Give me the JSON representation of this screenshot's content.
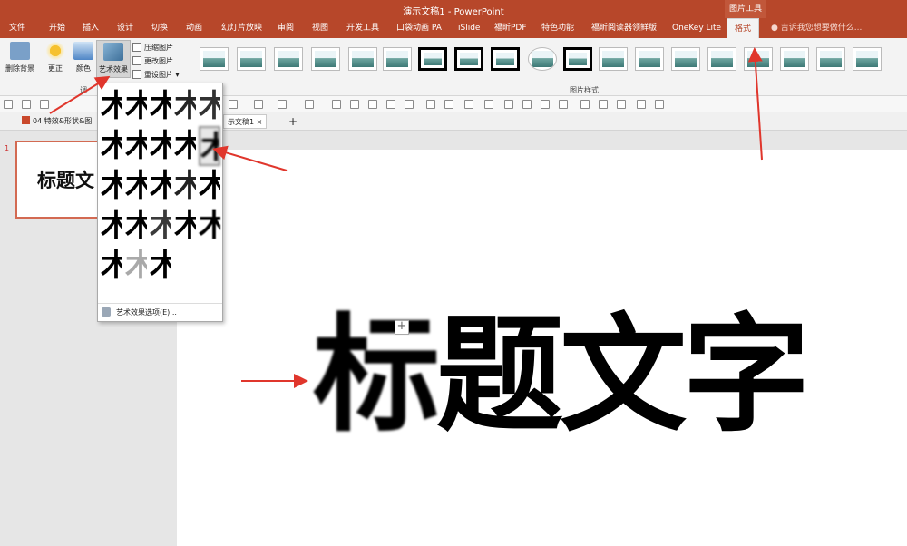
{
  "window": {
    "title": "演示文稿1 - PowerPoint",
    "context_group": "图片工具"
  },
  "tabs": [
    {
      "label": "文件"
    },
    {
      "label": "开始"
    },
    {
      "label": "插入"
    },
    {
      "label": "设计"
    },
    {
      "label": "切换"
    },
    {
      "label": "动画"
    },
    {
      "label": "幻灯片放映"
    },
    {
      "label": "审阅"
    },
    {
      "label": "视图"
    },
    {
      "label": "开发工具"
    },
    {
      "label": "口袋动画 PA"
    },
    {
      "label": "iSlide"
    },
    {
      "label": "福昕PDF"
    },
    {
      "label": "特色功能"
    },
    {
      "label": "福昕阅读器领鲜版"
    },
    {
      "label": "OneKey Lite"
    },
    {
      "label": "格式"
    }
  ],
  "tell_me": "吉诉我您想要做什么...",
  "ribbon": {
    "remove_bg": "删除背景",
    "corrections": "更正",
    "color": "颜色",
    "artistic_effects": "艺术效果",
    "compress": "压缩图片",
    "change": "更改图片",
    "reset": "重设图片",
    "styles_group": "图片样式",
    "adjust_group": "调"
  },
  "doc_tabs": {
    "file": "04 特效&形状&图",
    "active": "示文稿1"
  },
  "slide_thumb": {
    "number": "1",
    "text": "标题文"
  },
  "slide": {
    "title_first": "标",
    "title_rest": "题文字"
  },
  "artistic_menu": {
    "glyph": "木",
    "option_label": "艺术效果选项(E)..."
  },
  "colors": {
    "accent": "#b7472a",
    "arrow": "#e0362c"
  }
}
